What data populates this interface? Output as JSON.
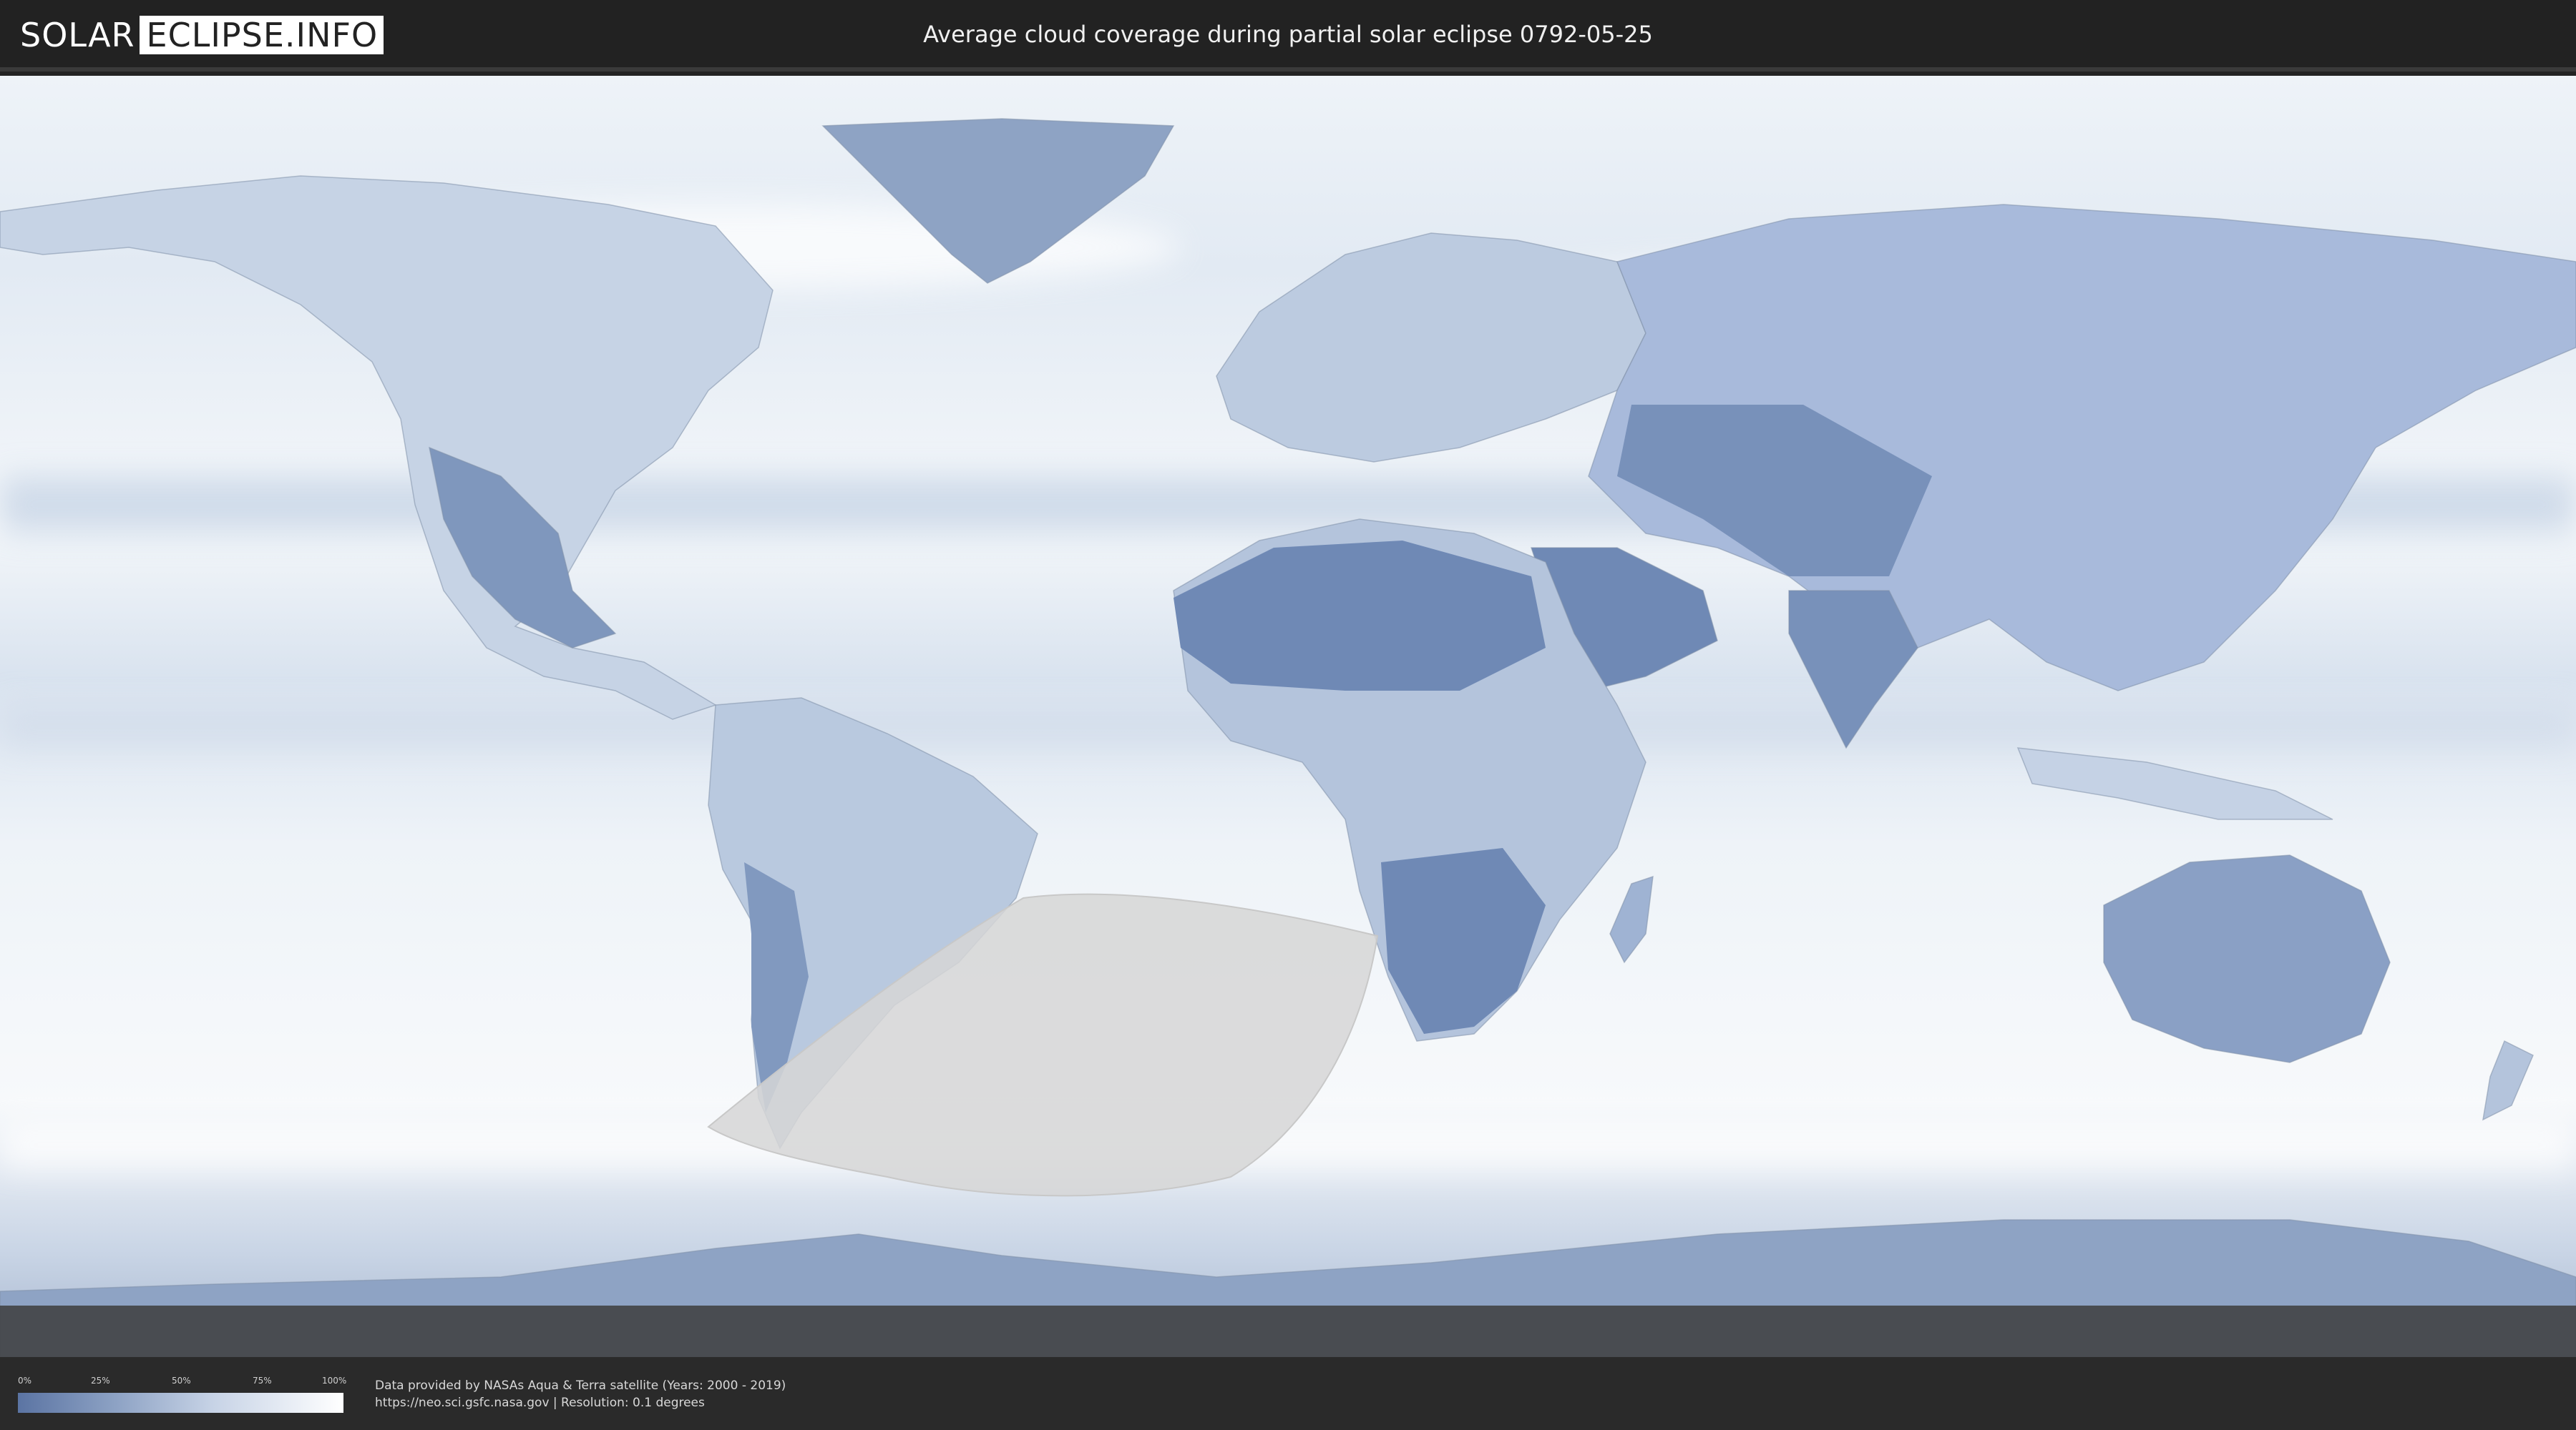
{
  "header": {
    "logo_left": "SOLAR",
    "logo_right": "ECLIPSE.INFO",
    "title": "Average cloud coverage during partial solar eclipse 0792-05-25"
  },
  "legend": {
    "ticks": [
      "0%",
      "25%",
      "50%",
      "75%",
      "100%"
    ],
    "gradient_colors": [
      "#5b74a3",
      "#8da2c4",
      "#c7d3e6",
      "#ffffff"
    ]
  },
  "footer": {
    "credit_line_1": "Data provided by NASAs Aqua & Terra satellite (Years: 2000 - 2019)",
    "credit_line_2": "https://neo.sci.gsfc.nasa.gov | Resolution: 0.1 degrees"
  },
  "colors": {
    "cloud_clear": "#5b74a3",
    "cloud_full": "#ffffff",
    "eclipse_zone": "#d6d6d6",
    "background": "#232323"
  }
}
